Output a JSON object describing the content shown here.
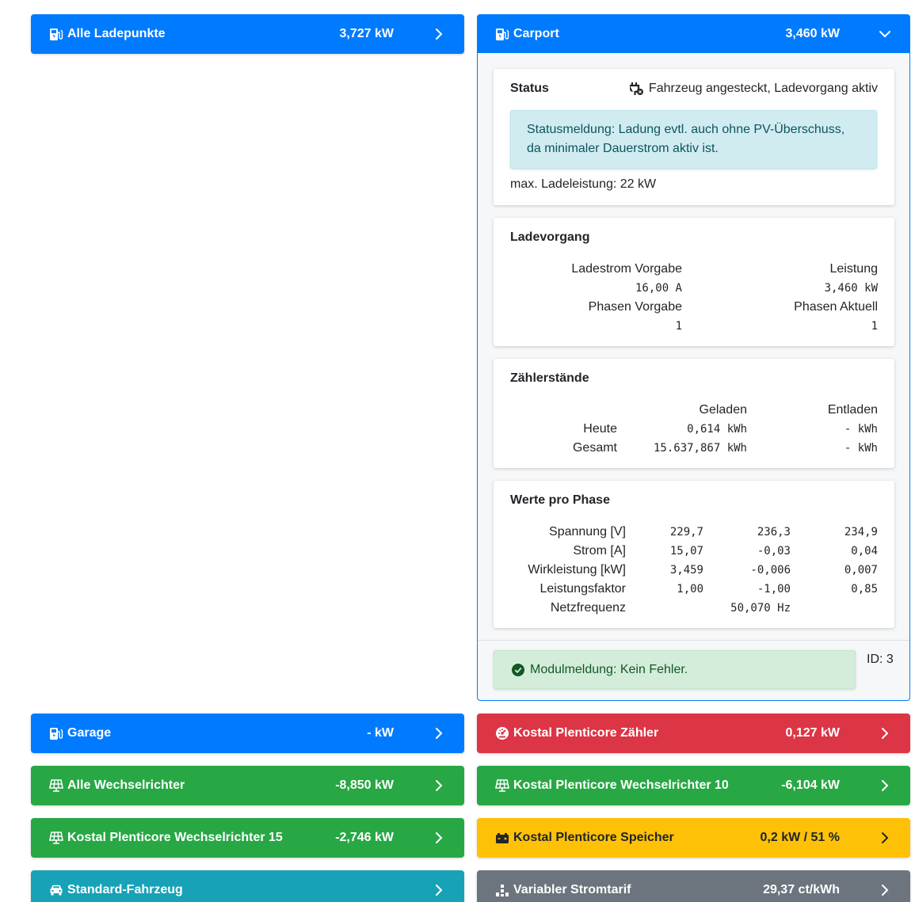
{
  "left_top_bar": {
    "icon": "charging-station-icon",
    "title": "Alle Ladepunkte",
    "value": "3,727 kW"
  },
  "carport": {
    "icon": "charging-station-icon",
    "title": "Carport",
    "value": "3,460 kW",
    "status": {
      "heading": "Status",
      "state_icon": "plug-icon",
      "state_text": "Fahrzeug angesteckt, Ladevorgang aktiv",
      "message": "Statusmeldung: Ladung evtl. auch ohne PV-Überschuss, da minimaler Dauerstrom aktiv ist.",
      "max_power": "max. Ladeleistung: 22 kW"
    },
    "charging": {
      "heading": "Ladevorgang",
      "current_label": "Ladestrom Vorgabe",
      "current_value": "16,00 A",
      "power_label": "Leistung",
      "power_value": "3,460 kW",
      "phases_set_label": "Phasen Vorgabe",
      "phases_set_value": "1",
      "phases_actual_label": "Phasen Aktuell",
      "phases_actual_value": "1"
    },
    "counters": {
      "heading": "Zählerstände",
      "col_charged": "Geladen",
      "col_discharged": "Entladen",
      "rows": [
        {
          "label": "Heute",
          "charged": "0,614 kWh",
          "discharged": "- kWh"
        },
        {
          "label": "Gesamt",
          "charged": "15.637,867 kWh",
          "discharged": "- kWh"
        }
      ]
    },
    "phases": {
      "heading": "Werte pro Phase",
      "rows": [
        {
          "label": "Spannung [V]",
          "v1": "229,7",
          "v2": "236,3",
          "v3": "234,9"
        },
        {
          "label": "Strom [A]",
          "v1": "15,07",
          "v2": "-0,03",
          "v3": "0,04"
        },
        {
          "label": "Wirkleistung [kW]",
          "v1": "3,459",
          "v2": "-0,006",
          "v3": "0,007"
        },
        {
          "label": "Leistungsfaktor",
          "v1": "1,00",
          "v2": "-1,00",
          "v3": "0,85"
        }
      ],
      "frequency_label": "Netzfrequenz",
      "frequency_value": "50,070 Hz"
    },
    "module_message": "Modulmeldung: Kein Fehler.",
    "id_label": "ID: 3"
  },
  "bars": [
    {
      "name": "garage",
      "icon": "charging-station-icon",
      "title": "Garage",
      "value": "- kW"
    },
    {
      "name": "counter",
      "icon": "tachometer-icon",
      "title": "Kostal Plenticore Zähler",
      "value": "0,127 kW"
    },
    {
      "name": "all-inverters",
      "icon": "solar-panel-icon",
      "title": "Alle Wechselrichter",
      "value": "-8,850 kW"
    },
    {
      "name": "inverter-10",
      "icon": "solar-panel-icon",
      "title": "Kostal Plenticore Wechselrichter 10",
      "value": "-6,104 kW"
    },
    {
      "name": "inverter-15",
      "icon": "solar-panel-icon",
      "title": "Kostal Plenticore Wechselrichter 15",
      "value": "-2,746 kW"
    },
    {
      "name": "storage",
      "icon": "car-battery-icon",
      "title": "Kostal Plenticore Speicher",
      "value": "0,2 kW / 51 %"
    },
    {
      "name": "vehicle",
      "icon": "car-icon",
      "title": "Standard-Fahrzeug",
      "value": ""
    },
    {
      "name": "tariff",
      "icon": "chart-steps-icon",
      "title": "Variabler Stromtarif",
      "value": "29,37 ct/kWh"
    }
  ],
  "colors": {
    "blue": "#007bff",
    "green": "#28a745",
    "red": "#dc3545",
    "yellow": "#ffc107",
    "teal": "#17a2b8",
    "gray": "#6c757d"
  }
}
